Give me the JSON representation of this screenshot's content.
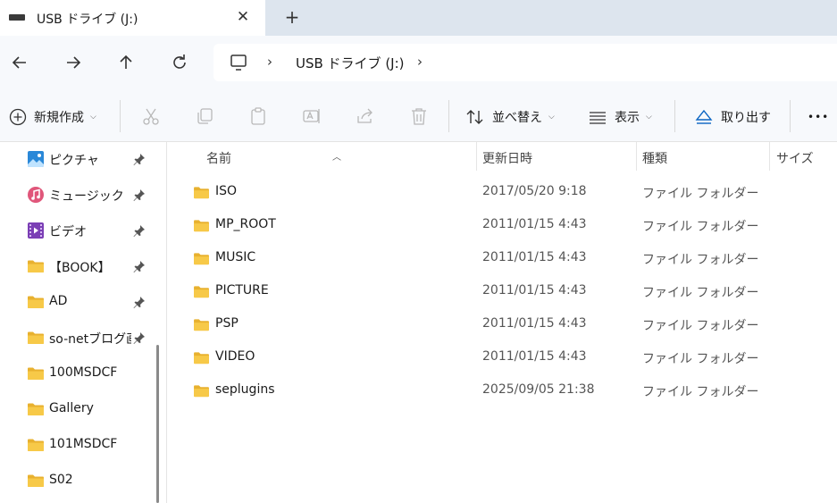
{
  "tab": {
    "title": "USB ドライブ (J:)",
    "close_glyph": "✕",
    "new_tab_glyph": "+"
  },
  "address": {
    "crumb": "USB ドライブ (J:)",
    "sep": "›"
  },
  "commands": {
    "new_label": "新規作成",
    "sort_label": "並べ替え",
    "view_label": "表示",
    "eject_label": "取り出す",
    "more_glyph": "•••"
  },
  "sidebar": {
    "items": [
      {
        "label": "ピクチャ",
        "icon": "pictures-icon",
        "pinned": true
      },
      {
        "label": "ミュージック",
        "icon": "music-icon",
        "pinned": true
      },
      {
        "label": "ビデオ",
        "icon": "videos-icon",
        "pinned": true
      },
      {
        "label": "【BOOK】",
        "icon": "folder-icon",
        "pinned": true
      },
      {
        "label": "AD",
        "icon": "folder-icon",
        "pinned": true
      },
      {
        "label": "so-netブログ画",
        "icon": "folder-icon",
        "pinned": true
      },
      {
        "label": "100MSDCF",
        "icon": "folder-icon",
        "pinned": false
      },
      {
        "label": "Gallery",
        "icon": "folder-icon",
        "pinned": false
      },
      {
        "label": "101MSDCF",
        "icon": "folder-icon",
        "pinned": false
      },
      {
        "label": "S02",
        "icon": "folder-icon",
        "pinned": false
      }
    ]
  },
  "columns": {
    "name": "名前",
    "date": "更新日時",
    "type": "種類",
    "size": "サイズ"
  },
  "files": [
    {
      "name": "ISO",
      "date": "2017/05/20 9:18",
      "type": "ファイル フォルダー"
    },
    {
      "name": "MP_ROOT",
      "date": "2011/01/15 4:43",
      "type": "ファイル フォルダー"
    },
    {
      "name": "MUSIC",
      "date": "2011/01/15 4:43",
      "type": "ファイル フォルダー"
    },
    {
      "name": "PICTURE",
      "date": "2011/01/15 4:43",
      "type": "ファイル フォルダー"
    },
    {
      "name": "PSP",
      "date": "2011/01/15 4:43",
      "type": "ファイル フォルダー"
    },
    {
      "name": "VIDEO",
      "date": "2011/01/15 4:43",
      "type": "ファイル フォルダー"
    },
    {
      "name": "seplugins",
      "date": "2025/09/05 21:38",
      "type": "ファイル フォルダー"
    }
  ],
  "colors": {
    "folder": "#f7c948",
    "folder_dark": "#e8b12f",
    "accent": "#0a64c2"
  }
}
